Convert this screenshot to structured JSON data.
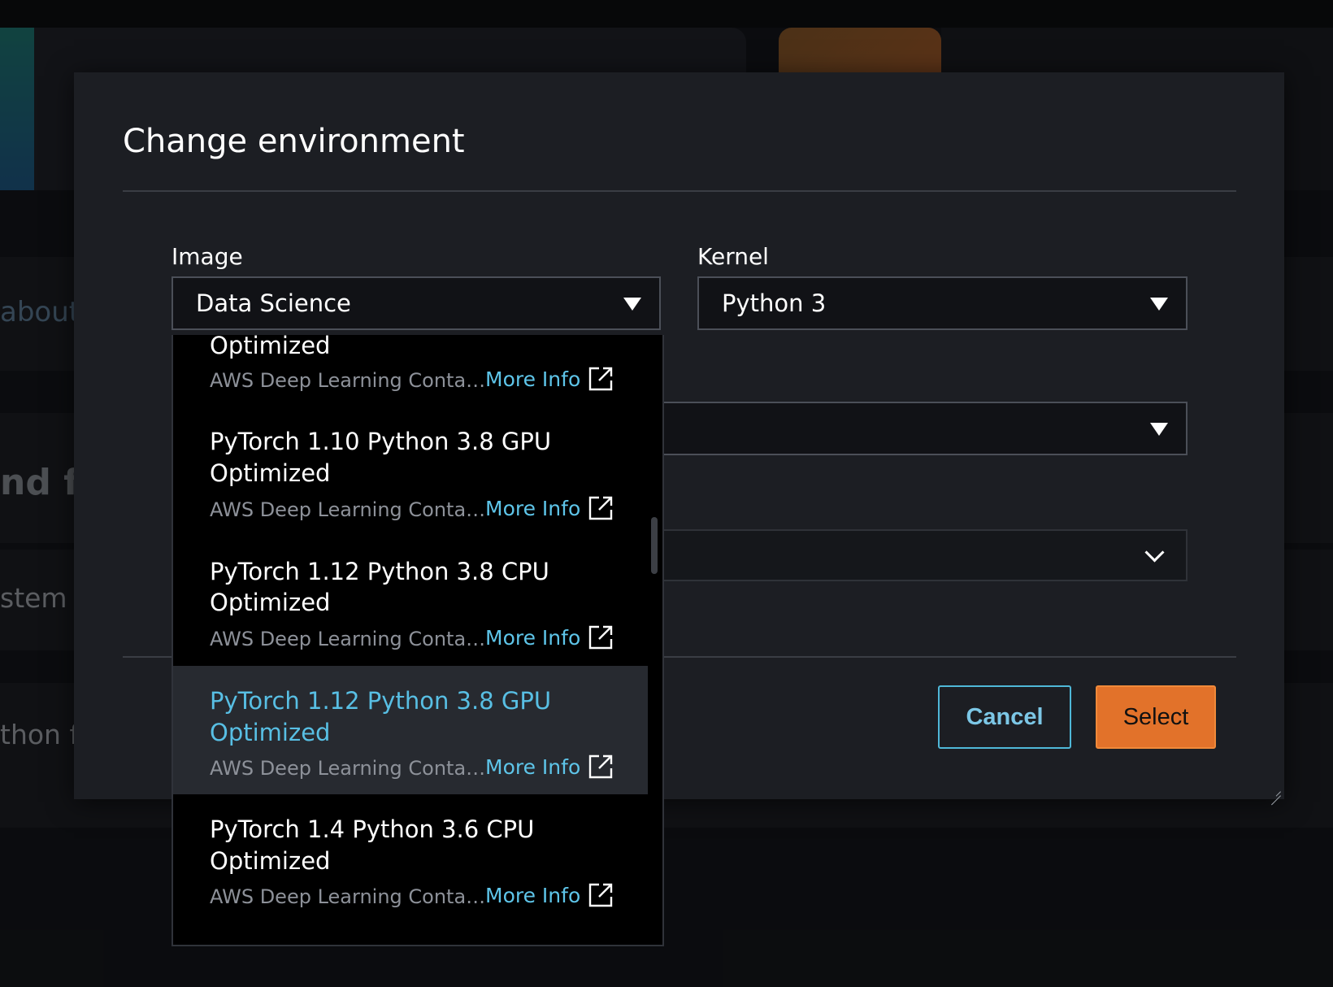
{
  "background": {
    "texts": [
      "about",
      "nd fil",
      "stem f",
      "thon f"
    ]
  },
  "modal": {
    "title": "Change environment",
    "image_label": "Image",
    "image_value": "Data Science",
    "kernel_label": "Kernel",
    "kernel_value": "Python 3",
    "cancel_label": "Cancel",
    "select_label": "Select"
  },
  "dropdown": {
    "options": [
      {
        "title_line1": "",
        "title_line2": "Optimized",
        "desc": "AWS Deep Learning Conta…",
        "more": "More Info"
      },
      {
        "title_line1": "PyTorch 1.10 Python 3.8 GPU",
        "title_line2": "Optimized",
        "desc": "AWS Deep Learning Conta…",
        "more": "More Info"
      },
      {
        "title_line1": "PyTorch 1.12 Python 3.8 CPU",
        "title_line2": "Optimized",
        "desc": "AWS Deep Learning Conta…",
        "more": "More Info"
      },
      {
        "title_line1": "PyTorch 1.12 Python 3.8 GPU",
        "title_line2": "Optimized",
        "desc": "AWS Deep Learning Conta…",
        "more": "More Info",
        "selected": true
      },
      {
        "title_line1": "PyTorch 1.4 Python 3.6 CPU",
        "title_line2": "Optimized",
        "desc": "AWS Deep Learning Conta…",
        "more": "More Info"
      }
    ]
  },
  "colors": {
    "accent_orange": "#e2722a",
    "link_blue": "#5ec5e9",
    "selected_text": "#58bfe4",
    "modal_bg": "#1c1e23"
  }
}
